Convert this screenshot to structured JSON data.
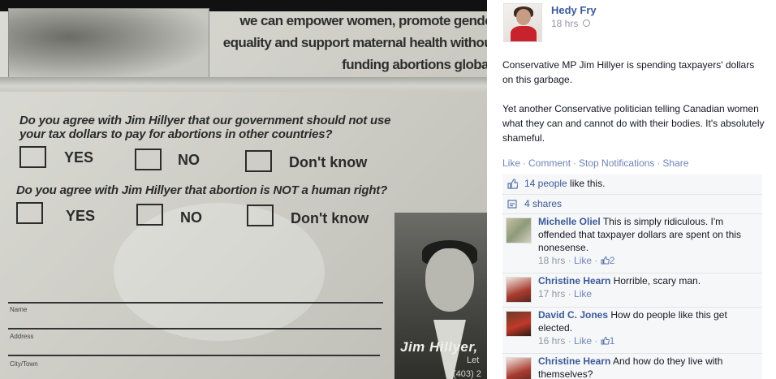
{
  "flyer": {
    "headline_lines": [
      "we can empower women, promote gende",
      "equality and support maternal health withou",
      "funding abortions global"
    ],
    "question1_lines": [
      "Do you agree with Jim Hillyer that our government should not use",
      "your tax dollars to pay for abortions in other countries?"
    ],
    "question2": "Do you agree with Jim Hillyer that abortion is NOT a human right?",
    "options": [
      "YES",
      "NO",
      "Don't know"
    ],
    "fields": [
      "Name",
      "Address",
      "City/Town"
    ],
    "signature": "Jim Hillyer,",
    "signature_sub1": "Let",
    "signature_sub2": "(403) 2"
  },
  "post": {
    "author": "Hedy Fry",
    "time": "18 hrs",
    "paragraph1": "Conservative MP Jim Hillyer is spending taxpayers' dollars on this garbage.",
    "paragraph2": "Yet another Conservative politician telling Canadian women what they can and cannot do with their bodies. It's absolutely shameful.",
    "actions": [
      "Like",
      "Comment",
      "Stop Notifications",
      "Share"
    ],
    "likes_link": "14 people",
    "likes_suffix": " like this.",
    "shares": "4 shares"
  },
  "comments": [
    {
      "name": "Michelle Oliel",
      "text": "This is simply ridiculous. I'm offended that taxpayer dollars are spent on this nonesense.",
      "time": "18 hrs",
      "like": "Like",
      "likes": "2"
    },
    {
      "name": "Christine Hearn",
      "text": "Horrible, scary man.",
      "time": "17 hrs",
      "like": "Like",
      "likes": ""
    },
    {
      "name": "David C. Jones",
      "text": "How do people like this get elected.",
      "time": "16 hrs",
      "like": "Like",
      "likes": "1"
    },
    {
      "name": "Christine Hearn",
      "text": "And how do they live with themselves?",
      "time": "",
      "like": "",
      "likes": ""
    }
  ],
  "colors": {
    "facebook_blue": "#3b5998",
    "link_blue": "#6d84b4",
    "meta_gray": "#9197a3",
    "ufi_bg": "#f6f7f8"
  },
  "icons": [
    "globe-icon",
    "like-thumb-icon",
    "share-icon"
  ]
}
